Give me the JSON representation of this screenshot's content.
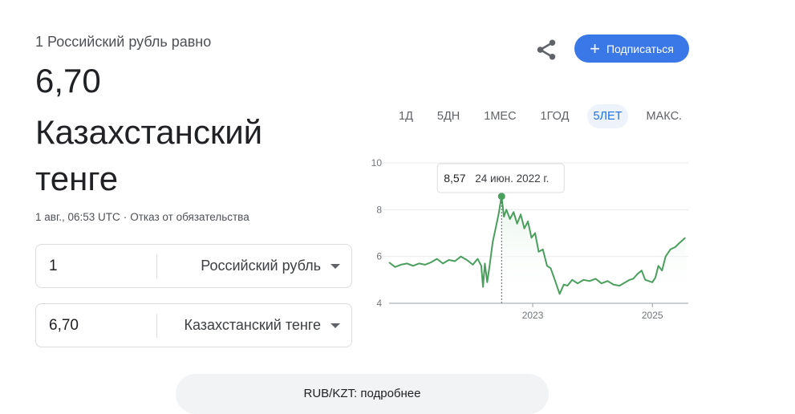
{
  "header": {
    "subtitle": "1 Российский рубль равно",
    "value": "6,70",
    "target_currency": "Казахстанский тенге",
    "timestamp": "1 авг., 06:53 UTC",
    "separator": "·",
    "disclaimer": "Отказ от обязательства"
  },
  "converter": {
    "from": {
      "amount": "1",
      "currency": "Российский рубль"
    },
    "to": {
      "amount": "6,70",
      "currency": "Казахстанский тенге"
    }
  },
  "actions": {
    "share_icon": "share-icon",
    "subscribe_label": "Подписаться",
    "subscribe_color": "#3b78e7"
  },
  "tabs": [
    {
      "label": "1Д",
      "active": false
    },
    {
      "label": "5ДН",
      "active": false
    },
    {
      "label": "1МЕС",
      "active": false
    },
    {
      "label": "1ГОД",
      "active": false
    },
    {
      "label": "5ЛЕТ",
      "active": true
    },
    {
      "label": "МАКС.",
      "active": false
    }
  ],
  "tooltip": {
    "value": "8,57",
    "date": "24 июн. 2022 г."
  },
  "more_link": "RUB/KZT: подробнее",
  "chart_data": {
    "type": "line",
    "title": "",
    "xlabel": "",
    "ylabel": "",
    "color": "#4a9f5d",
    "ylim": [
      4,
      10
    ],
    "yticks": [
      10,
      8,
      6,
      4
    ],
    "xlim": [
      2020.6,
      2025.6
    ],
    "xticks": [
      {
        "value": 2023.0,
        "label": "2023"
      },
      {
        "value": 2025.0,
        "label": "2025"
      }
    ],
    "highlight": {
      "x": 2022.48,
      "y": 8.57
    },
    "grid": true,
    "series": [
      {
        "x": [
          2020.6,
          2020.7,
          2020.8,
          2020.9,
          2021.0,
          2021.1,
          2021.2,
          2021.3,
          2021.4,
          2021.5,
          2021.6,
          2021.7,
          2021.8,
          2021.9,
          2022.0,
          2022.08,
          2022.14,
          2022.17,
          2022.2,
          2022.24,
          2022.28,
          2022.33,
          2022.38,
          2022.43,
          2022.48,
          2022.52,
          2022.56,
          2022.62,
          2022.68,
          2022.74,
          2022.8,
          2022.86,
          2022.92,
          2022.98,
          2023.04,
          2023.1,
          2023.17,
          2023.24,
          2023.3,
          2023.37,
          2023.45,
          2023.52,
          2023.58,
          2023.66,
          2023.75,
          2023.85,
          2023.95,
          2024.05,
          2024.15,
          2024.25,
          2024.35,
          2024.45,
          2024.55,
          2024.62,
          2024.68,
          2024.75,
          2024.82,
          2024.88,
          2024.94,
          2025.0,
          2025.05,
          2025.1,
          2025.16,
          2025.22,
          2025.3,
          2025.38,
          2025.46,
          2025.55
        ],
        "y": [
          5.75,
          5.55,
          5.65,
          5.7,
          5.6,
          5.7,
          5.65,
          5.75,
          5.9,
          5.7,
          5.85,
          5.8,
          6.0,
          5.85,
          5.65,
          5.9,
          5.6,
          4.7,
          5.7,
          4.9,
          5.6,
          6.6,
          7.2,
          7.8,
          8.57,
          7.7,
          8.0,
          7.6,
          7.9,
          7.4,
          7.8,
          7.2,
          7.5,
          6.8,
          7.0,
          6.2,
          6.3,
          5.6,
          5.5,
          5.0,
          4.4,
          4.8,
          4.75,
          5.0,
          4.85,
          5.0,
          4.95,
          5.05,
          4.85,
          4.95,
          4.8,
          4.75,
          4.9,
          5.0,
          5.05,
          5.25,
          5.4,
          5.0,
          4.95,
          4.9,
          5.1,
          5.6,
          5.4,
          6.0,
          6.3,
          6.4,
          6.6,
          6.8
        ]
      }
    ]
  }
}
